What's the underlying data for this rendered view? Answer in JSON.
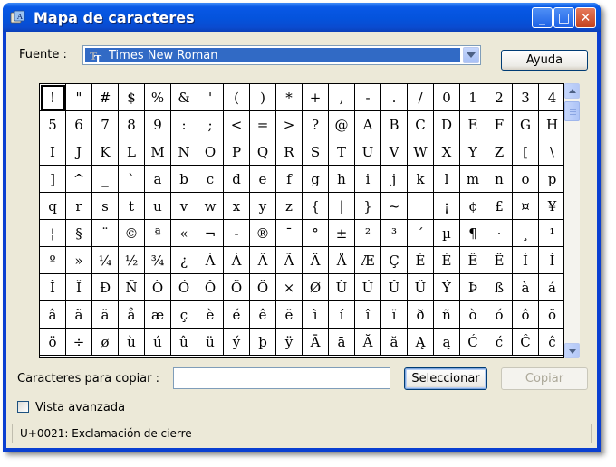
{
  "window": {
    "title": "Mapa de caracteres",
    "minimize_glyph": "_",
    "maximize_glyph": "□",
    "close_glyph": "✕"
  },
  "font": {
    "label": "Fuente :",
    "selected": "Times New Roman",
    "icon": "truetype-font-icon"
  },
  "help_button": "Ayuda",
  "char_grid": {
    "selected_index": 0,
    "rows": [
      [
        "!",
        "\"",
        "#",
        "$",
        "%",
        "&",
        "'",
        "(",
        ")",
        "*",
        "+",
        ",",
        "-",
        ".",
        "/",
        "0",
        "1",
        "2",
        "3",
        "4"
      ],
      [
        "5",
        "6",
        "7",
        "8",
        "9",
        ":",
        ";",
        "<",
        "=",
        ">",
        "?",
        "@",
        "A",
        "B",
        "C",
        "D",
        "E",
        "F",
        "G",
        "H"
      ],
      [
        "I",
        "J",
        "K",
        "L",
        "M",
        "N",
        "O",
        "P",
        "Q",
        "R",
        "S",
        "T",
        "U",
        "V",
        "W",
        "X",
        "Y",
        "Z",
        "[",
        "\\"
      ],
      [
        "]",
        "^",
        "_",
        "`",
        "a",
        "b",
        "c",
        "d",
        "e",
        "f",
        "g",
        "h",
        "i",
        "j",
        "k",
        "l",
        "m",
        "n",
        "o",
        "p"
      ],
      [
        "q",
        "r",
        "s",
        "t",
        "u",
        "v",
        "w",
        "x",
        "y",
        "z",
        "{",
        "|",
        "}",
        "~",
        "",
        "¡",
        "¢",
        "£",
        "¤",
        "¥"
      ],
      [
        "¦",
        "§",
        "¨",
        "©",
        "ª",
        "«",
        "¬",
        "-",
        "®",
        "¯",
        "°",
        "±",
        "²",
        "³",
        "´",
        "µ",
        "¶",
        "·",
        "¸",
        "¹"
      ],
      [
        "º",
        "»",
        "¼",
        "½",
        "¾",
        "¿",
        "À",
        "Á",
        "Â",
        "Ã",
        "Ä",
        "Å",
        "Æ",
        "Ç",
        "È",
        "É",
        "Ê",
        "Ë",
        "Ì",
        "Í"
      ],
      [
        "Î",
        "Ï",
        "Ð",
        "Ñ",
        "Ò",
        "Ó",
        "Ô",
        "Õ",
        "Ö",
        "×",
        "Ø",
        "Ù",
        "Ú",
        "Û",
        "Ü",
        "Ý",
        "Þ",
        "ß",
        "à",
        "á"
      ],
      [
        "â",
        "ã",
        "ä",
        "å",
        "æ",
        "ç",
        "è",
        "é",
        "ê",
        "ë",
        "ì",
        "í",
        "î",
        "ï",
        "ð",
        "ñ",
        "ò",
        "ó",
        "ô",
        "õ"
      ],
      [
        "ö",
        "÷",
        "ø",
        "ù",
        "ú",
        "û",
        "ü",
        "ý",
        "þ",
        "ÿ",
        "Ā",
        "ā",
        "Ă",
        "ă",
        "Ą",
        "ą",
        "Ć",
        "ć",
        "Ĉ",
        "ĉ"
      ]
    ]
  },
  "copy": {
    "label": "Caracteres para copiar :",
    "value": "",
    "select_button": "Seleccionar",
    "copy_button": "Copiar"
  },
  "advanced_view": {
    "label": "Vista avanzada",
    "checked": false
  },
  "status_text": "U+0021: Exclamación de cierre"
}
